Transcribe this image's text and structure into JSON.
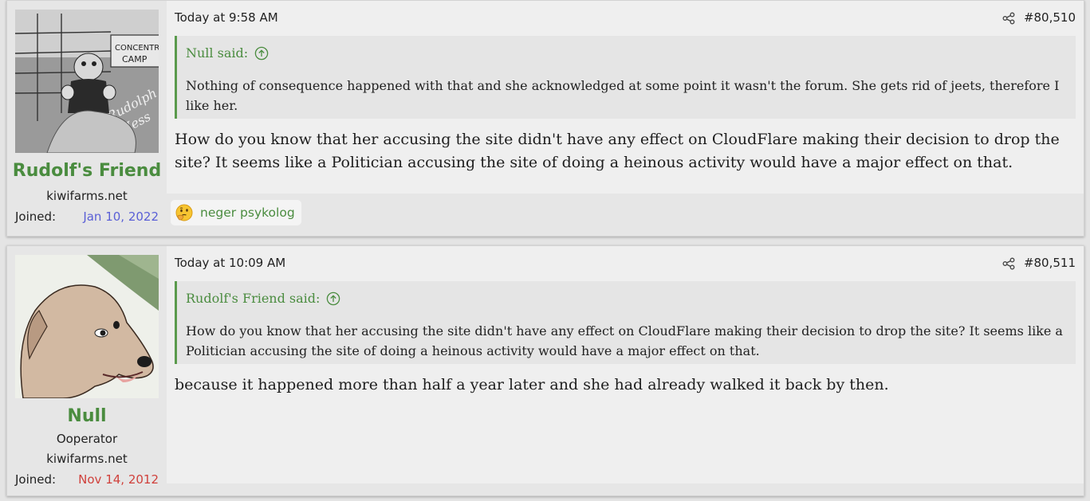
{
  "posts": [
    {
      "author": {
        "name": "Rudolf's Friend",
        "site": "kiwifarms.net",
        "joined_label": "Joined:",
        "joined_date": "Jan 10, 2022",
        "joined_color": "#5a5fd6",
        "avatar_caption_1": "CONCENTRATION",
        "avatar_caption_2": "CAMP",
        "avatar_caption_3": "Rudolph",
        "avatar_caption_4": "Hess"
      },
      "date": "Today at 9:58 AM",
      "number": "#80,510",
      "quote": {
        "author": "Null said:",
        "text": "Nothing of consequence happened with that and she acknowledged at some point it wasn't the forum. She gets rid of jeets, therefore I like her."
      },
      "message": "How do you know that her accusing the site didn't have any effect on CloudFlare making their decision to drop the site? It seems like a Politician accusing the site of doing a heinous activity would have a major effect on that.",
      "reaction": {
        "icon": "thinking-face-icon",
        "label": "neger psykolog"
      }
    },
    {
      "author": {
        "name": "Null",
        "title": "Ooperator",
        "site": "kiwifarms.net",
        "joined_label": "Joined:",
        "joined_date": "Nov 14, 2012",
        "joined_color": "#d0413c"
      },
      "date": "Today at 10:09 AM",
      "number": "#80,511",
      "quote": {
        "author": "Rudolf's Friend said:",
        "text": "How do you know that her accusing the site didn't have any effect on CloudFlare making their decision to drop the site? It seems like a Politician accusing the site of doing a heinous activity would have a major effect on that."
      },
      "message": "because it happened more than half a year later and she had already walked it back by then."
    }
  ],
  "colors": {
    "accent_green": "#4a8c3f",
    "quote_border": "#5a9a4c",
    "post_bg": "#efefef",
    "user_bg": "#e6e6e6"
  }
}
